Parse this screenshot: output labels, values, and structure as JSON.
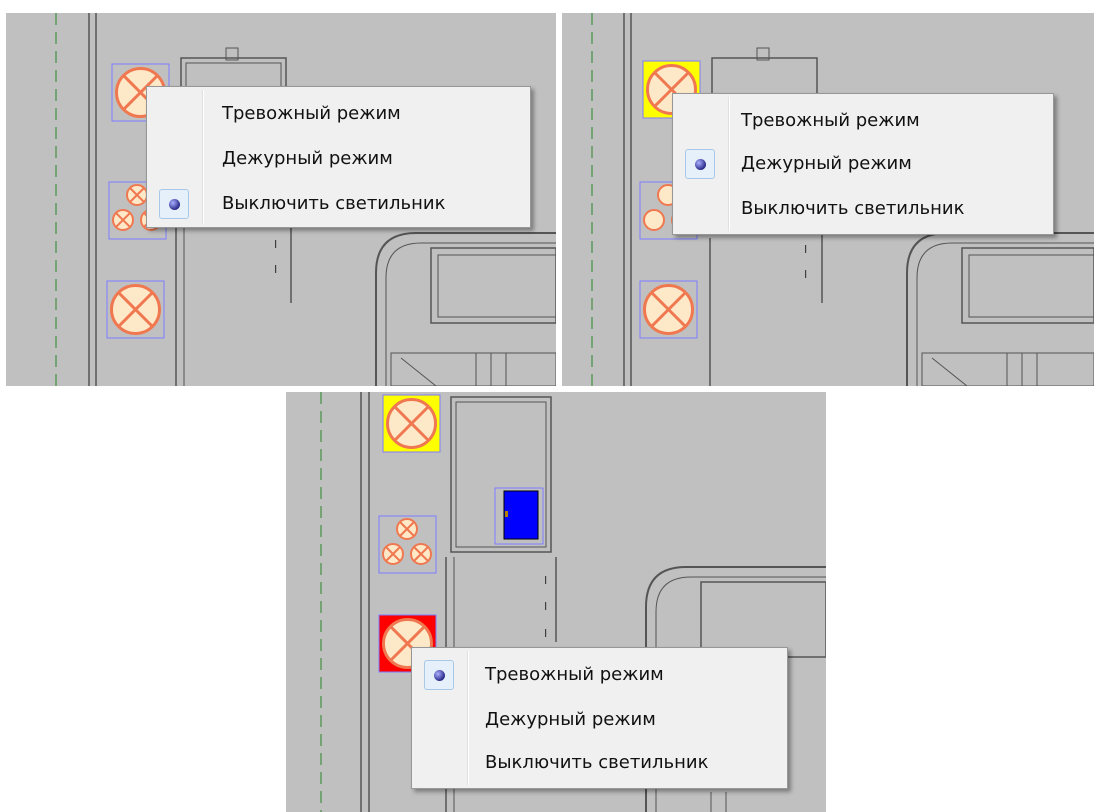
{
  "panels": [
    {
      "menu": {
        "items": [
          {
            "label": "Тревожный режим",
            "checked": false
          },
          {
            "label": "Дежурный режим",
            "checked": false
          },
          {
            "label": "Выключить светильник",
            "checked": true
          }
        ]
      }
    },
    {
      "menu": {
        "items": [
          {
            "label": "Тревожный режим",
            "checked": false
          },
          {
            "label": "Дежурный режим",
            "checked": true
          },
          {
            "label": "Выключить светильник",
            "checked": false
          }
        ]
      }
    },
    {
      "menu": {
        "items": [
          {
            "label": "Тревожный режим",
            "checked": true
          },
          {
            "label": "Дежурный режим",
            "checked": false
          },
          {
            "label": "Выключить светильник",
            "checked": false
          }
        ]
      }
    }
  ],
  "colors": {
    "canvas": "#c0c0c0",
    "lamp_fill": "#fde8c8",
    "lamp_stroke": "#f07850",
    "alarm_bg": "#ff0000",
    "duty_bg": "#ffff00",
    "device": "#0000ff"
  },
  "icons": [
    "lamp-icon",
    "lamp-group-icon",
    "radio-dot-icon",
    "device-icon"
  ]
}
